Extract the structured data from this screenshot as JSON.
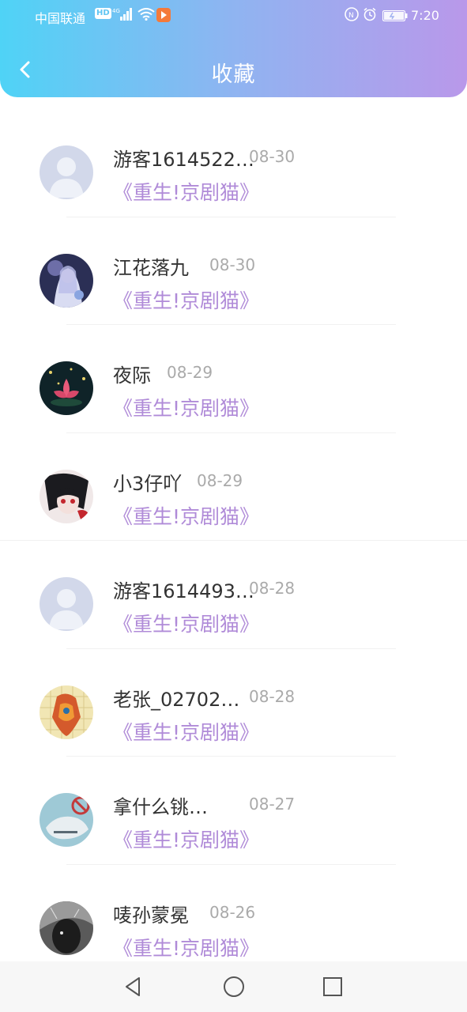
{
  "status_bar": {
    "carrier": "中国联通",
    "hd": "HD",
    "time": "7:20"
  },
  "header": {
    "title": "收藏"
  },
  "items": [
    {
      "username": "游客1614522…",
      "date": "08-30",
      "title": "《重生!京剧猫》",
      "avatar": "default-avatar"
    },
    {
      "username": "江花落九",
      "date": "08-30",
      "title": "《重生!京剧猫》",
      "avatar": "anime-girl-avatar"
    },
    {
      "username": "夜际",
      "date": "08-29",
      "title": "《重生!京剧猫》",
      "avatar": "lotus-avatar"
    },
    {
      "username": "小3仔吖",
      "date": "08-29",
      "title": "《重生!京剧猫》",
      "avatar": "dark-character-avatar"
    },
    {
      "username": "游客1614493…",
      "date": "08-28",
      "title": "《重生!京剧猫》",
      "avatar": "default-avatar"
    },
    {
      "username": "老张_02702…",
      "date": "08-28",
      "title": "《重生!京剧猫》",
      "avatar": "mosaic-avatar"
    },
    {
      "username": "拿什么铫…",
      "date": "08-27",
      "title": "《重生!京剧猫》",
      "avatar": "hand-avatar"
    },
    {
      "username": "唛孙蒙冕",
      "date": "08-26",
      "title": "《重生!京剧猫》",
      "avatar": "monochrome-avatar"
    }
  ],
  "colors": {
    "header_start": "#4fd3f6",
    "header_end": "#b998ea",
    "accent_title": "#b08bd8",
    "date_gray": "#aaaaaa"
  }
}
